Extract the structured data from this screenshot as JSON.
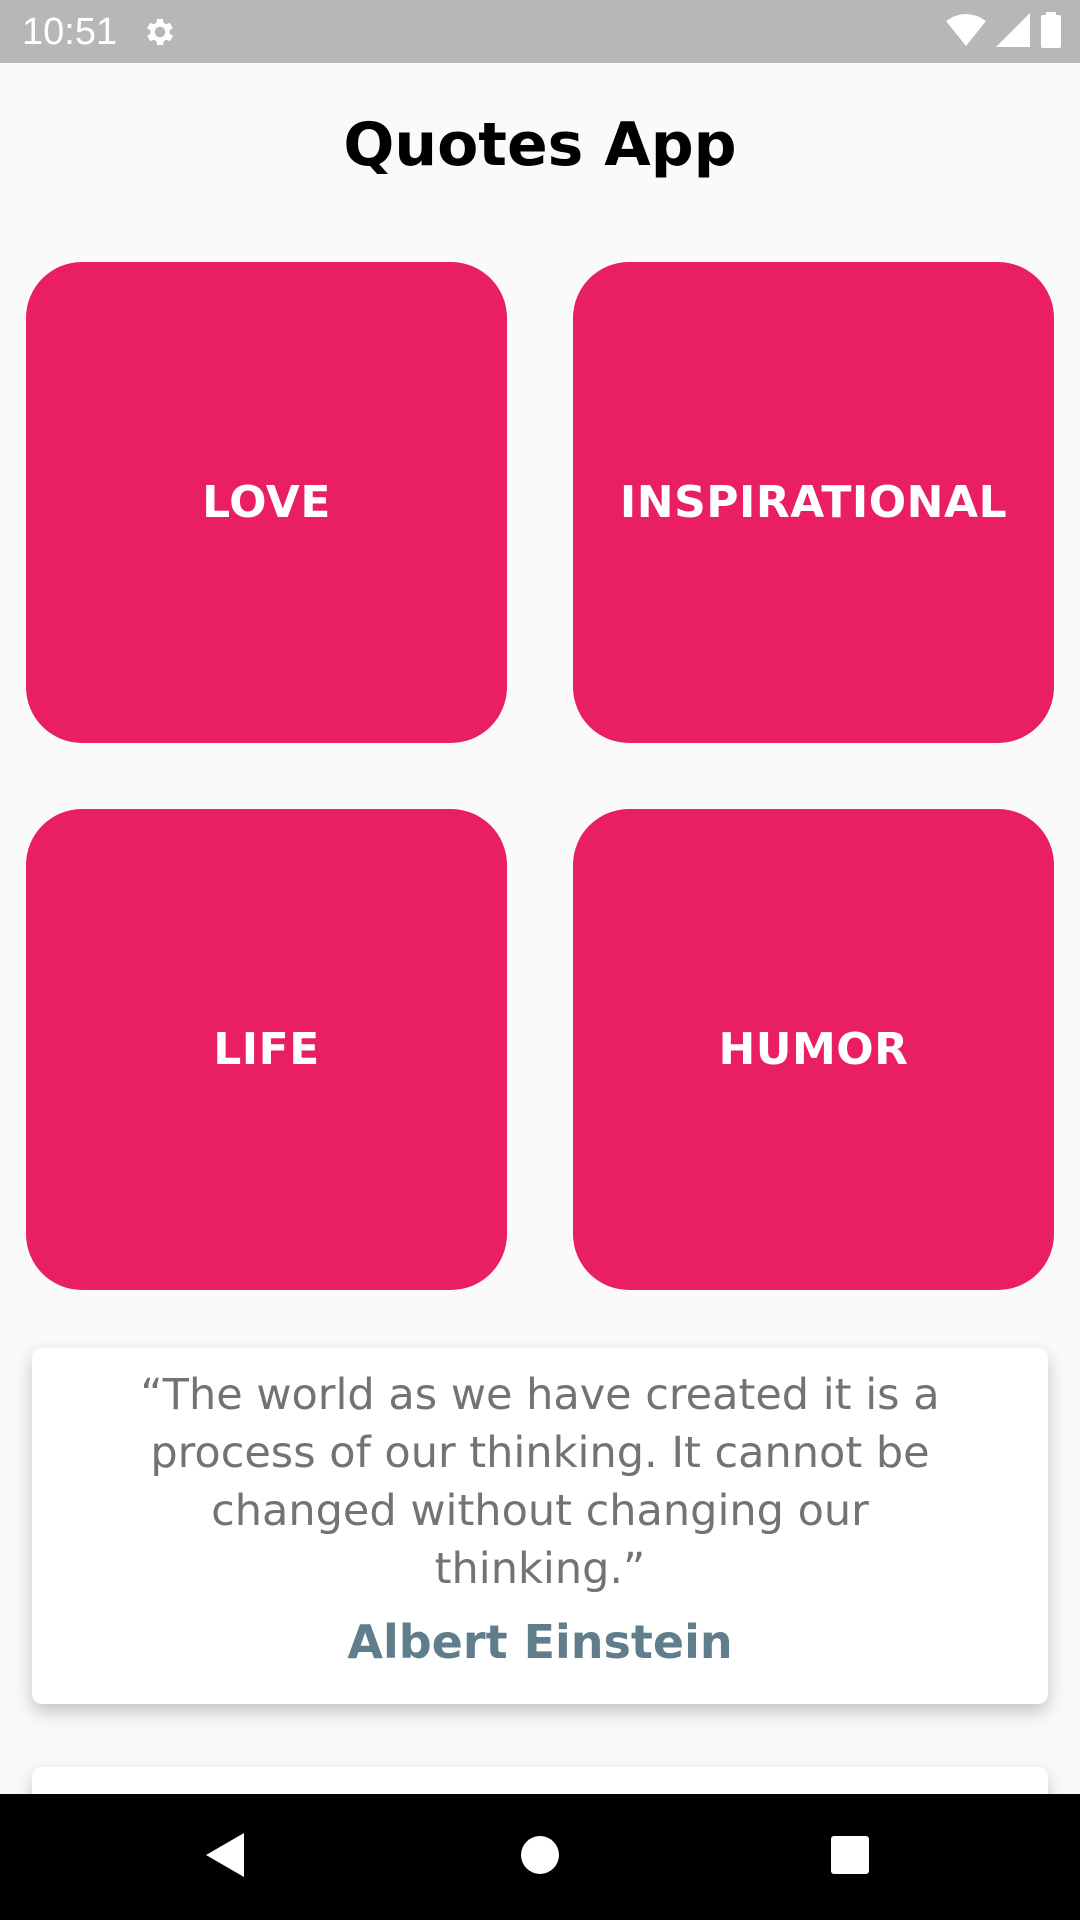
{
  "status_bar": {
    "time": "10:51",
    "icons": [
      "gear-icon",
      "wifi-icon",
      "cell-signal-icon",
      "battery-icon"
    ]
  },
  "app": {
    "title": "Quotes App"
  },
  "categories": [
    {
      "label": "LOVE"
    },
    {
      "label": "INSPIRATIONAL"
    },
    {
      "label": "LIFE"
    },
    {
      "label": "HUMOR"
    }
  ],
  "quote": {
    "text": "“The world as we have created it is a process of our thinking. It cannot be changed without changing our thinking.”",
    "author": "Albert Einstein"
  },
  "colors": {
    "accent": "#e91e63",
    "author": "#607d8b",
    "quote_text": "#737373",
    "status_bar": "#b7b7b7",
    "background": "#fafafa"
  },
  "nav_bar": {
    "icons": [
      "back-icon",
      "home-icon",
      "recents-icon"
    ]
  }
}
